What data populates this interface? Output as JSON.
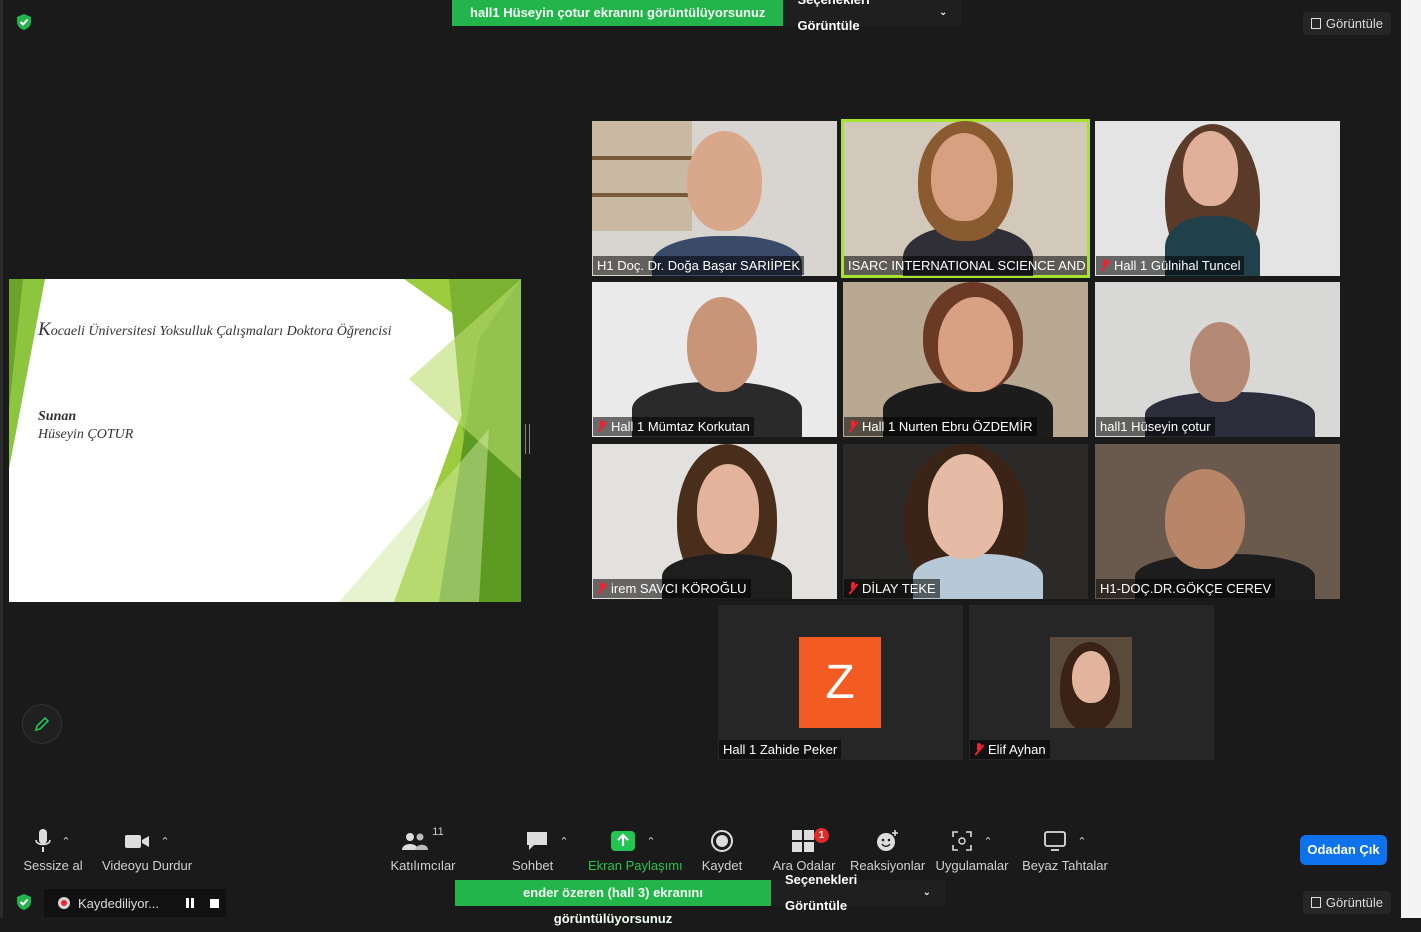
{
  "top_banner": {
    "sharing_text": "hall1 Hüseyin çotur ekranını görüntülüyorsunuz",
    "options_label": "Seçenekleri Görüntüle"
  },
  "view_label": "Görüntüle",
  "slide": {
    "line1_initial": "K",
    "line1_rest": "ocaeli Üniversitesi Yoksulluk Çalışmaları Doktora Öğrencisi",
    "sunan": "Sunan",
    "presenter": "Hüseyin ÇOTUR"
  },
  "participants": [
    {
      "name": "H1 Doç. Dr. Doğa Başar SARIİPEK",
      "muted": false,
      "active": false
    },
    {
      "name": "ISARC INTERNATIONAL SCIENCE AND ...",
      "muted": false,
      "active": true
    },
    {
      "name": "Hall 1 Gülnihal Tuncel",
      "muted": true,
      "active": false
    },
    {
      "name": "Hall 1 Mümtaz Korkutan",
      "muted": true,
      "active": false
    },
    {
      "name": "Hall 1 Nurten Ebru ÖZDEMİR",
      "muted": true,
      "active": false
    },
    {
      "name": "hall1 Hüseyin çotur",
      "muted": false,
      "active": false
    },
    {
      "name": "irem SAVCI KÖROĞLU",
      "muted": true,
      "active": false
    },
    {
      "name": "DİLAY TEKE",
      "muted": true,
      "active": false
    },
    {
      "name": "H1-DOÇ.DR.GÖKÇE CEREV",
      "muted": false,
      "active": false
    },
    {
      "name": "Hall 1 Zahide Peker",
      "muted": false,
      "active": false,
      "avatar_letter": "Z"
    },
    {
      "name": "Elif Ayhan",
      "muted": true,
      "active": false
    }
  ],
  "toolbar": {
    "mute": "Sessize al",
    "video": "Videoyu Durdur",
    "participants": "Katılımcılar",
    "participant_count": "11",
    "chat": "Sohbet",
    "share": "Ekran Paylaşımı",
    "record": "Kaydet",
    "breakout": "Ara Odalar",
    "breakout_badge": "1",
    "reactions": "Reaksiyonlar",
    "apps": "Uygulamalar",
    "whiteboard": "Beyaz Tahtalar",
    "leave": "Odadan Çık"
  },
  "bottom_banner": {
    "sharing_text": "ender özeren (hall 3) ekranını görüntülüyorsunuz",
    "options_label": "Seçenekleri Görüntüle"
  },
  "recording": {
    "label": "Kaydediliyor..."
  },
  "colors": {
    "share_green": "#23b54c",
    "active_speaker": "#a6e22e",
    "leave_blue": "#0e72ed",
    "avatar_orange": "#f25c22",
    "mute_red": "#e22233"
  }
}
